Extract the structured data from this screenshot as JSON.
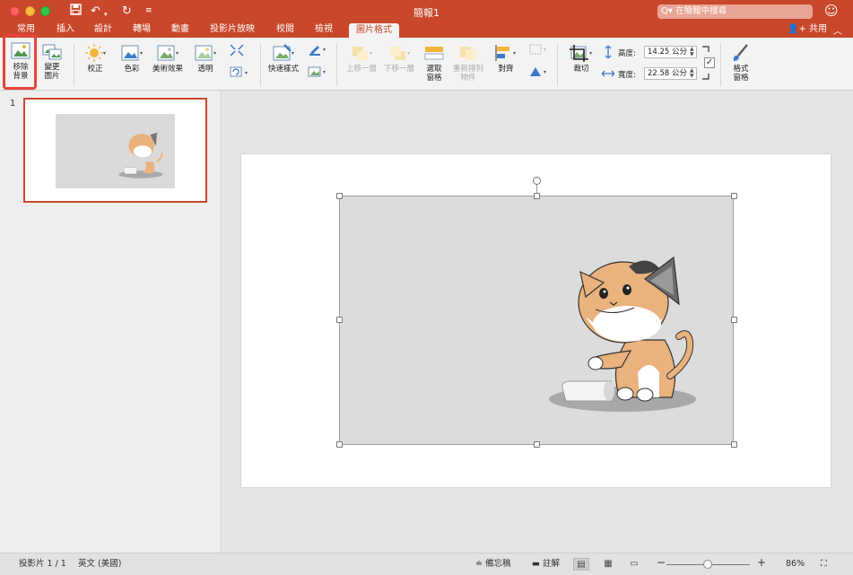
{
  "window": {
    "title": "簡報1",
    "search_placeholder": "在簡報中搜尋",
    "share_label": "共用"
  },
  "tabs": [
    "常用",
    "插入",
    "設計",
    "轉場",
    "動畫",
    "投影片放映",
    "校閱",
    "檢視",
    "圖片格式"
  ],
  "active_tab": "圖片格式",
  "ribbon": {
    "remove_background": "移除背景",
    "change_picture": "變更圖片",
    "corrections": "校正",
    "color": "色彩",
    "artistic_effects": "美術效果",
    "transparency": "透明",
    "quick_styles": "快速樣式",
    "bring_forward": "上移一層",
    "send_backward": "下移一層",
    "selection_pane": "選取窗格",
    "reorder_objects": "重新排列物件",
    "align": "對齊",
    "crop": "裁切",
    "height_label": "高度:",
    "height_value": "14.25 公分",
    "width_label": "寬度:",
    "width_value": "22.58 公分",
    "format_pane": "格式窗格"
  },
  "slides_panel": {
    "slide_number": "1"
  },
  "status": {
    "slide_info": "投影片 1 / 1",
    "language": "英文 (美國)",
    "notes": "備忘稿",
    "comments": "註解",
    "zoom": "86%"
  },
  "colors": {
    "accent": "#c9472a",
    "highlight": "#e5443a",
    "picture_bg": "#dcdcdc"
  }
}
